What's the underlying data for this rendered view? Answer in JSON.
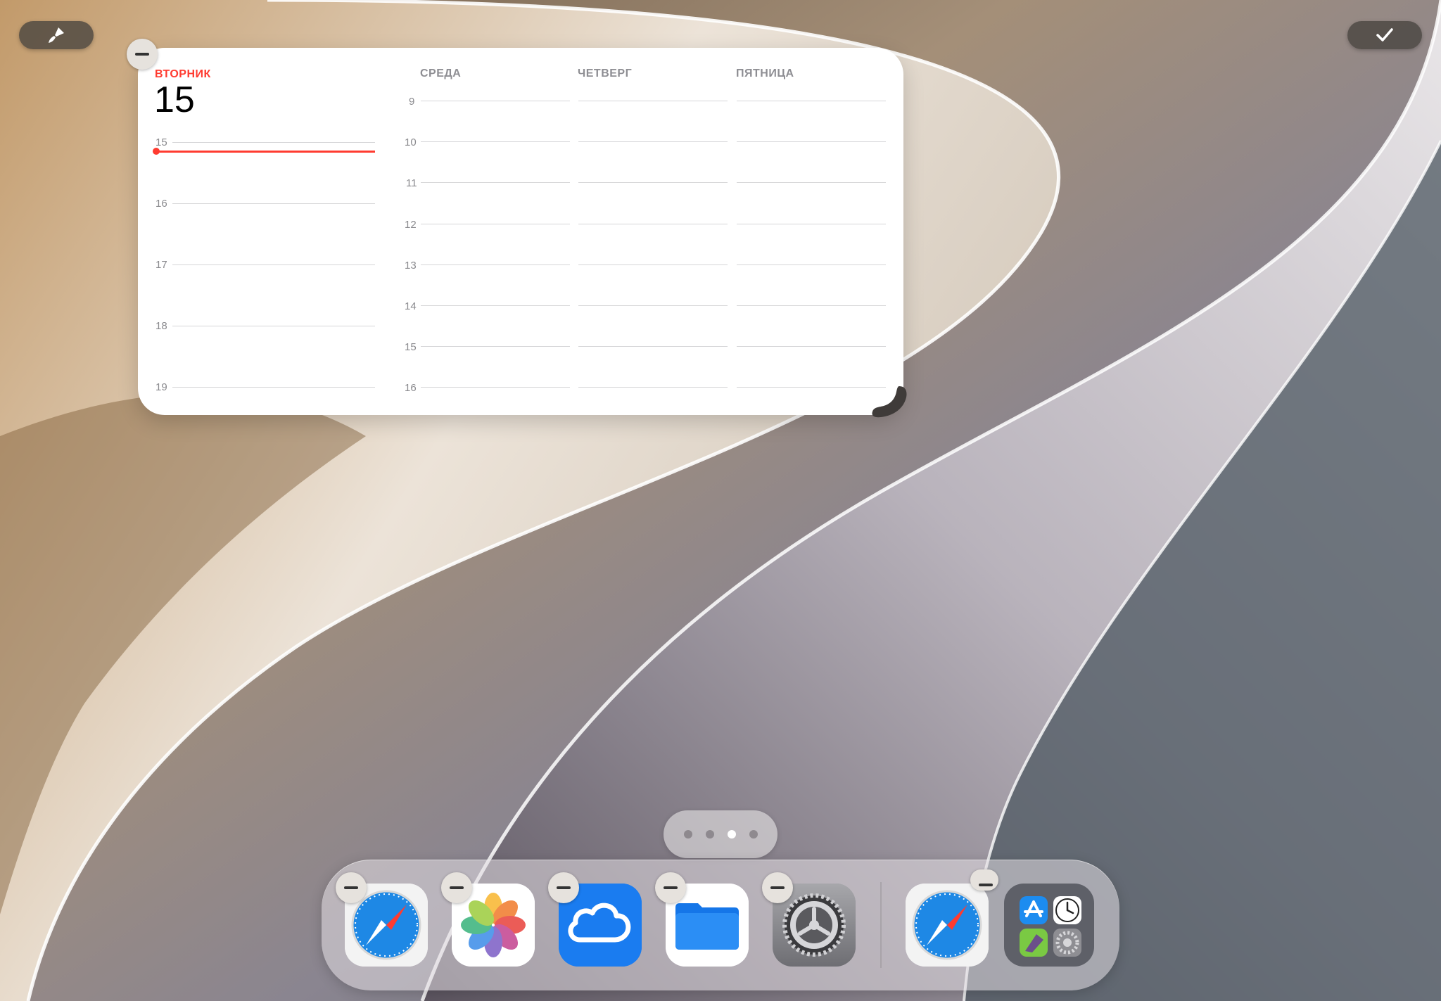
{
  "toolbar": {
    "edit_icon": "paintbrush-icon",
    "done_icon": "checkmark-icon"
  },
  "calendar_widget": {
    "today": {
      "weekday": "ВТОРНИК",
      "date": "15",
      "hours": [
        "15",
        "16",
        "17",
        "18",
        "19"
      ]
    },
    "upcoming_hours": [
      "9",
      "10",
      "11",
      "12",
      "13",
      "14",
      "15",
      "16"
    ],
    "upcoming_days": [
      "СРЕДА",
      "ЧЕТВЕРГ",
      "ПЯТНИЦА"
    ],
    "accent_color": "#ff3b30"
  },
  "page_indicator": {
    "pages": 4,
    "current_page": 3
  },
  "dock": {
    "apps": [
      {
        "name": "Safari",
        "icon": "safari-compass-icon"
      },
      {
        "name": "Photos",
        "icon": "photos-flower-icon"
      },
      {
        "name": "iCloud",
        "icon": "cloud-icon"
      },
      {
        "name": "Files",
        "icon": "folder-icon"
      },
      {
        "name": "Settings",
        "icon": "gear-icon"
      }
    ],
    "recent": [
      {
        "name": "Safari",
        "icon": "safari-compass-icon"
      },
      {
        "name": "App Library",
        "icon": "app-library-icon"
      }
    ]
  }
}
